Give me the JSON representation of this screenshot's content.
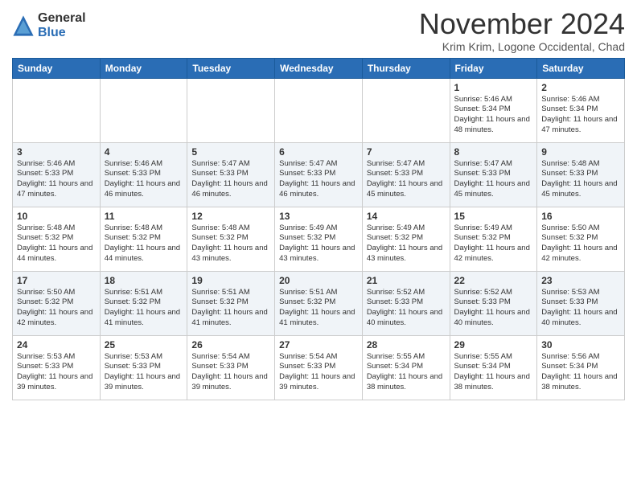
{
  "logo": {
    "general": "General",
    "blue": "Blue"
  },
  "title": "November 2024",
  "subtitle": "Krim Krim, Logone Occidental, Chad",
  "days_of_week": [
    "Sunday",
    "Monday",
    "Tuesday",
    "Wednesday",
    "Thursday",
    "Friday",
    "Saturday"
  ],
  "weeks": [
    [
      {
        "day": "",
        "info": ""
      },
      {
        "day": "",
        "info": ""
      },
      {
        "day": "",
        "info": ""
      },
      {
        "day": "",
        "info": ""
      },
      {
        "day": "",
        "info": ""
      },
      {
        "day": "1",
        "info": "Sunrise: 5:46 AM\nSunset: 5:34 PM\nDaylight: 11 hours and 48 minutes."
      },
      {
        "day": "2",
        "info": "Sunrise: 5:46 AM\nSunset: 5:34 PM\nDaylight: 11 hours and 47 minutes."
      }
    ],
    [
      {
        "day": "3",
        "info": "Sunrise: 5:46 AM\nSunset: 5:33 PM\nDaylight: 11 hours and 47 minutes."
      },
      {
        "day": "4",
        "info": "Sunrise: 5:46 AM\nSunset: 5:33 PM\nDaylight: 11 hours and 46 minutes."
      },
      {
        "day": "5",
        "info": "Sunrise: 5:47 AM\nSunset: 5:33 PM\nDaylight: 11 hours and 46 minutes."
      },
      {
        "day": "6",
        "info": "Sunrise: 5:47 AM\nSunset: 5:33 PM\nDaylight: 11 hours and 46 minutes."
      },
      {
        "day": "7",
        "info": "Sunrise: 5:47 AM\nSunset: 5:33 PM\nDaylight: 11 hours and 45 minutes."
      },
      {
        "day": "8",
        "info": "Sunrise: 5:47 AM\nSunset: 5:33 PM\nDaylight: 11 hours and 45 minutes."
      },
      {
        "day": "9",
        "info": "Sunrise: 5:48 AM\nSunset: 5:33 PM\nDaylight: 11 hours and 45 minutes."
      }
    ],
    [
      {
        "day": "10",
        "info": "Sunrise: 5:48 AM\nSunset: 5:32 PM\nDaylight: 11 hours and 44 minutes."
      },
      {
        "day": "11",
        "info": "Sunrise: 5:48 AM\nSunset: 5:32 PM\nDaylight: 11 hours and 44 minutes."
      },
      {
        "day": "12",
        "info": "Sunrise: 5:48 AM\nSunset: 5:32 PM\nDaylight: 11 hours and 43 minutes."
      },
      {
        "day": "13",
        "info": "Sunrise: 5:49 AM\nSunset: 5:32 PM\nDaylight: 11 hours and 43 minutes."
      },
      {
        "day": "14",
        "info": "Sunrise: 5:49 AM\nSunset: 5:32 PM\nDaylight: 11 hours and 43 minutes."
      },
      {
        "day": "15",
        "info": "Sunrise: 5:49 AM\nSunset: 5:32 PM\nDaylight: 11 hours and 42 minutes."
      },
      {
        "day": "16",
        "info": "Sunrise: 5:50 AM\nSunset: 5:32 PM\nDaylight: 11 hours and 42 minutes."
      }
    ],
    [
      {
        "day": "17",
        "info": "Sunrise: 5:50 AM\nSunset: 5:32 PM\nDaylight: 11 hours and 42 minutes."
      },
      {
        "day": "18",
        "info": "Sunrise: 5:51 AM\nSunset: 5:32 PM\nDaylight: 11 hours and 41 minutes."
      },
      {
        "day": "19",
        "info": "Sunrise: 5:51 AM\nSunset: 5:32 PM\nDaylight: 11 hours and 41 minutes."
      },
      {
        "day": "20",
        "info": "Sunrise: 5:51 AM\nSunset: 5:32 PM\nDaylight: 11 hours and 41 minutes."
      },
      {
        "day": "21",
        "info": "Sunrise: 5:52 AM\nSunset: 5:33 PM\nDaylight: 11 hours and 40 minutes."
      },
      {
        "day": "22",
        "info": "Sunrise: 5:52 AM\nSunset: 5:33 PM\nDaylight: 11 hours and 40 minutes."
      },
      {
        "day": "23",
        "info": "Sunrise: 5:53 AM\nSunset: 5:33 PM\nDaylight: 11 hours and 40 minutes."
      }
    ],
    [
      {
        "day": "24",
        "info": "Sunrise: 5:53 AM\nSunset: 5:33 PM\nDaylight: 11 hours and 39 minutes."
      },
      {
        "day": "25",
        "info": "Sunrise: 5:53 AM\nSunset: 5:33 PM\nDaylight: 11 hours and 39 minutes."
      },
      {
        "day": "26",
        "info": "Sunrise: 5:54 AM\nSunset: 5:33 PM\nDaylight: 11 hours and 39 minutes."
      },
      {
        "day": "27",
        "info": "Sunrise: 5:54 AM\nSunset: 5:33 PM\nDaylight: 11 hours and 39 minutes."
      },
      {
        "day": "28",
        "info": "Sunrise: 5:55 AM\nSunset: 5:34 PM\nDaylight: 11 hours and 38 minutes."
      },
      {
        "day": "29",
        "info": "Sunrise: 5:55 AM\nSunset: 5:34 PM\nDaylight: 11 hours and 38 minutes."
      },
      {
        "day": "30",
        "info": "Sunrise: 5:56 AM\nSunset: 5:34 PM\nDaylight: 11 hours and 38 minutes."
      }
    ]
  ]
}
